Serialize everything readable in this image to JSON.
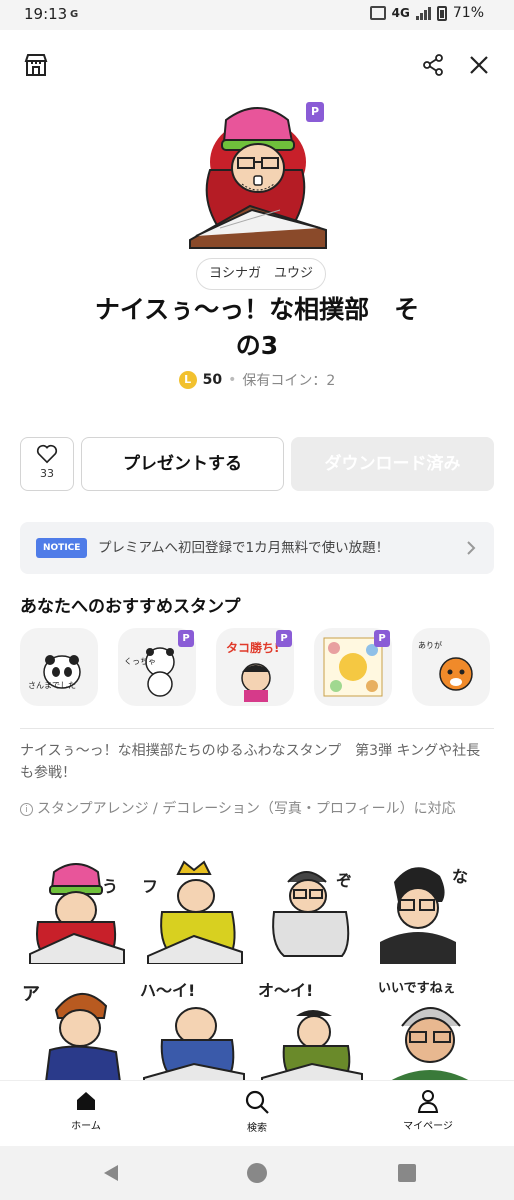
{
  "status_bar": {
    "time": "19:13",
    "carrier_icon": "G",
    "network": "4G",
    "battery": "71%"
  },
  "top_bar": {
    "shop_icon": "shop-icon",
    "share_icon": "share-icon",
    "close_icon": "close-icon"
  },
  "product": {
    "premium_badge": "P",
    "author": "ヨシナガ　ユウジ",
    "title_line1": "ナイスぅ〜っ！な相撲部　そ",
    "title_line2": "の3",
    "coin_symbol": "L",
    "price": "50",
    "owned_coins": "保有コイン：2"
  },
  "actions": {
    "like_count": "33",
    "present_label": "プレゼントする",
    "download_label": "ダウンロード済み"
  },
  "notice": {
    "badge": "NOTICE",
    "text": "プレミアムへ初回登録で1カ月無料で使い放題！"
  },
  "recommendations": {
    "title": "あなたへのおすすめスタンプ",
    "items": [
      {
        "text": "おつかれさんまでした",
        "premium": false
      },
      {
        "text": "くっちゃくっちゃ",
        "premium": true
      },
      {
        "text": "タコ勝ち!",
        "premium": true
      },
      {
        "text": "",
        "premium": true
      },
      {
        "text": "ありがとうって言ってよ",
        "premium": false
      }
    ]
  },
  "description": "ナイスぅ〜っ！な相撲部たちのゆるふわなスタンプ　第3弾 キングや社長も参戦！",
  "feature_note": "スタンプアレンジ / デコレーション（写真・プロフィール）に対応",
  "stickers": [
    {
      "text": ""
    },
    {
      "text": "フゥ〜"
    },
    {
      "text": "ぞぞ〜"
    },
    {
      "text": "なぐ〜"
    },
    {
      "text": "アチ〜"
    },
    {
      "text": "ハ〜イ!"
    },
    {
      "text": "オ〜イ!"
    },
    {
      "text": "いいですねぇ"
    }
  ],
  "bottom_nav": {
    "home": "ホーム",
    "search": "検索",
    "mypage": "マイページ"
  },
  "colors": {
    "accent_blue": "#4f7ce8",
    "premium_purple": "#8a5cd6",
    "coin_yellow": "#f2c12e"
  }
}
